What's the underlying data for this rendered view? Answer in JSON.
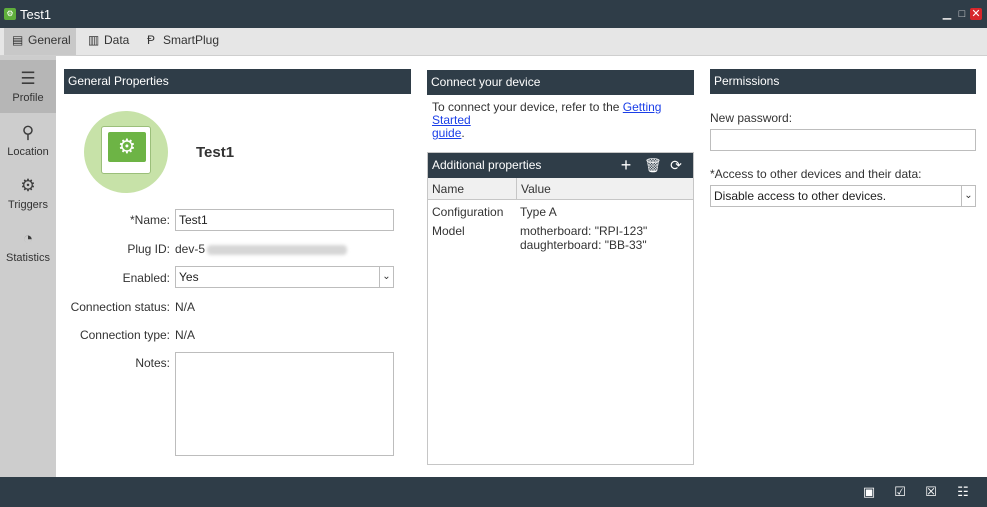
{
  "window": {
    "title": "Test1"
  },
  "tabs": [
    {
      "label": "General",
      "icon": "document-icon"
    },
    {
      "label": "Data",
      "icon": "bar-chart-icon"
    },
    {
      "label": "SmartPlug",
      "icon": "plug-icon"
    }
  ],
  "nav": [
    {
      "label": "Profile",
      "icon": "profile-icon"
    },
    {
      "label": "Location",
      "icon": "location-icon"
    },
    {
      "label": "Triggers",
      "icon": "triggers-icon"
    },
    {
      "label": "Statistics",
      "icon": "statistics-icon"
    }
  ],
  "general": {
    "header": "General Properties",
    "device_name": "Test1",
    "name_label": "*Name:",
    "name_value": "Test1",
    "plug_id_label": "Plug ID:",
    "plug_id_value": "dev-5",
    "enabled_label": "Enabled:",
    "enabled_value": "Yes",
    "conn_status_label": "Connection status:",
    "conn_status_value": "N/A",
    "conn_type_label": "Connection type:",
    "conn_type_value": "N/A",
    "notes_label": "Notes:"
  },
  "connect": {
    "header": "Connect your device",
    "text_before": "To connect your device, refer to the ",
    "link_text_1": "Getting Started",
    "link_text_2": "guide",
    "text_after": "."
  },
  "additional": {
    "header": "Additional properties",
    "columns": [
      "Name",
      "Value"
    ],
    "rows": [
      {
        "name": "Configuration",
        "value": "Type A"
      },
      {
        "name": "Model",
        "value": "motherboard: \"RPI-123\"\ndaughterboard: \"BB-33\""
      }
    ]
  },
  "permissions": {
    "header": "Permissions",
    "password_label": "New password:",
    "access_label": "*Access to other devices and their data:",
    "access_value": "Disable access to other devices."
  },
  "colors": {
    "header_bg": "#2f3d48",
    "accent_green": "#6db445",
    "close_red": "#d7262b",
    "link_blue": "#1a3ee8"
  }
}
